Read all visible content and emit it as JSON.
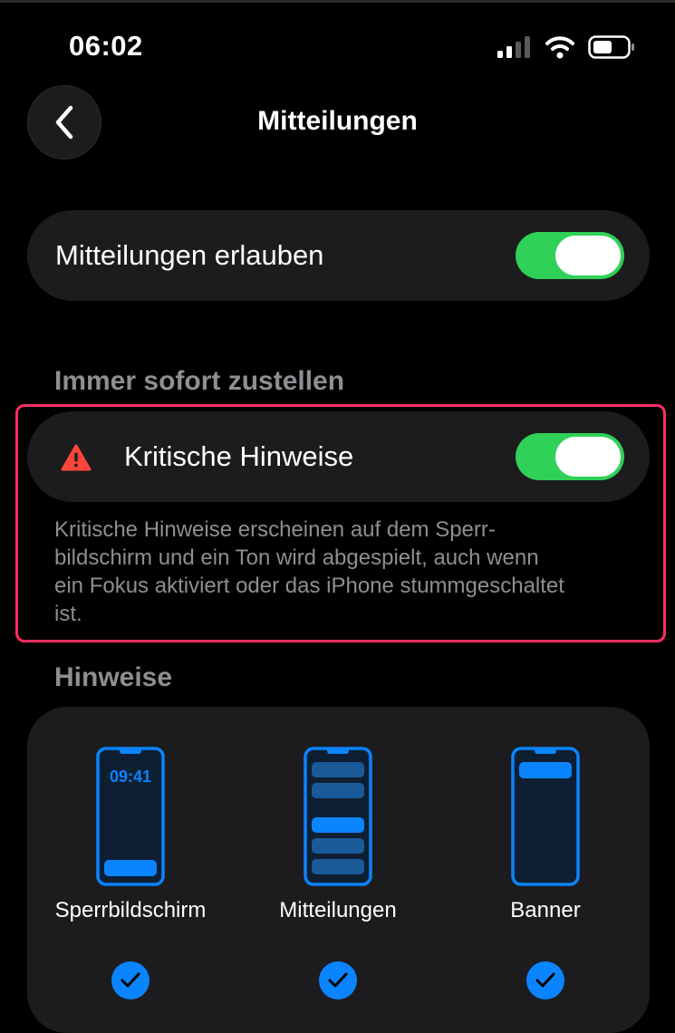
{
  "status_bar": {
    "time": "06:02"
  },
  "header": {
    "title": "Mitteilungen"
  },
  "allow_row": {
    "label": "Mitteilungen erlauben",
    "enabled": true
  },
  "section_immediate": {
    "title": "Immer sofort zustellen"
  },
  "critical_row": {
    "label": "Kritische Hinweise",
    "enabled": true
  },
  "critical_footer": {
    "lines": [
      "Kritische Hinweise erscheinen auf dem Sperr-",
      "bildschirm und ein Ton wird abgespielt, auch wenn",
      "ein Fokus aktiviert oder das iPhone stummgeschaltet",
      "ist."
    ]
  },
  "section_alerts": {
    "title": "Hinweise"
  },
  "alert_options": [
    {
      "label": "Sperrbildschirm",
      "preview_time": "09:41",
      "selected": true
    },
    {
      "label": "Mitteilungen",
      "selected": true
    },
    {
      "label": "Banner",
      "selected": true
    }
  ],
  "colors": {
    "toggle_on": "#30d158",
    "accent_blue": "#0a84ff",
    "warning_red": "#ff453a",
    "highlight": "#ff2d63"
  }
}
